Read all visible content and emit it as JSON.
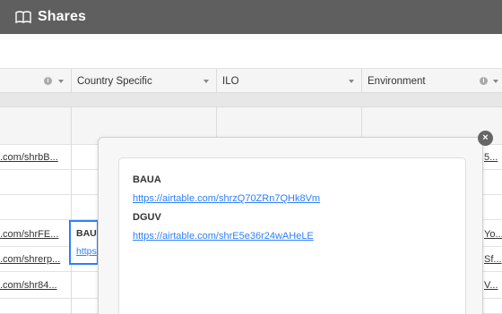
{
  "app": {
    "title": "Shares",
    "icon": "book-icon"
  },
  "columns": [
    {
      "label": "",
      "has_info": true
    },
    {
      "label": "Country Specific",
      "has_info": false
    },
    {
      "label": "ILO",
      "has_info": false
    },
    {
      "label": "Environment",
      "has_info": true
    }
  ],
  "rows": [
    {
      "link": ".com/shrbB...",
      "right": "5..."
    },
    {
      "link": "",
      "right": ""
    },
    {
      "link": "",
      "right": ""
    },
    {
      "link": ".com/shrFE...",
      "right": "Yo..."
    },
    {
      "link": ".com/shrerp...",
      "right": "Sf..."
    },
    {
      "link": ".com/shr84...",
      "right": "V..."
    }
  ],
  "selected_cell": {
    "title": "BAUA",
    "link": "https"
  },
  "popup": {
    "entries": [
      {
        "name": "BAUA",
        "url": "https://airtable.com/shrzQ70ZRn7QHk8Vm"
      },
      {
        "name": "DGUV",
        "url": "https://airtable.com/shrE5e36r24wAHeLE"
      }
    ],
    "close_symbol": "×"
  },
  "colors": {
    "titlebar": "#5f5f5f",
    "link": "#2d7ff9",
    "selection": "#2d7ff9"
  }
}
